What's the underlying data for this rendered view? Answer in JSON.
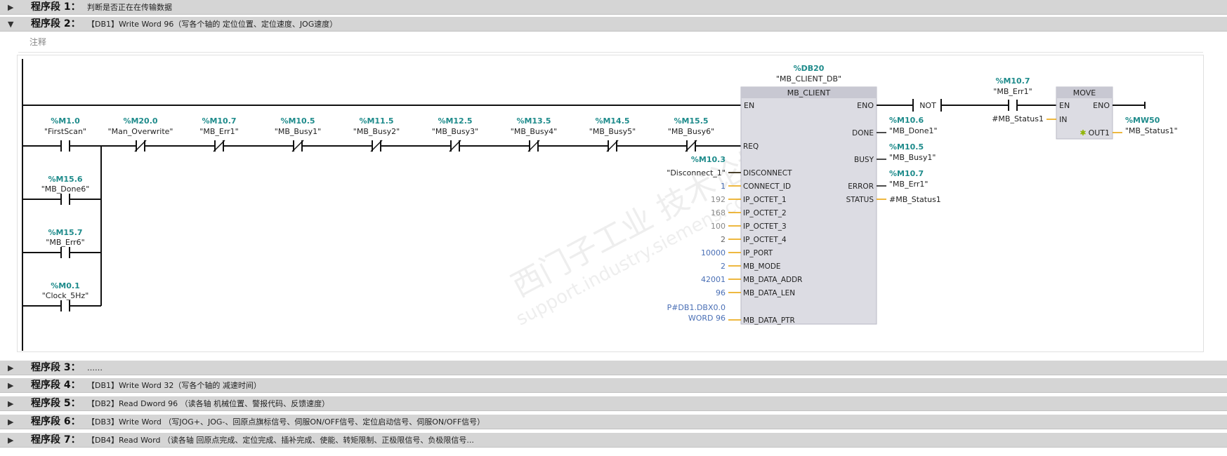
{
  "segments": [
    {
      "title": "程序段 1：",
      "desc": "判断是否正在在传输数据",
      "expanded": false
    },
    {
      "title": "程序段 2：",
      "desc": "【DB1】Write Word 96（写各个轴的 定位位置、定位速度、JOG速度）",
      "expanded": true
    },
    {
      "title": "程序段 3：",
      "desc": "……",
      "expanded": false
    },
    {
      "title": "程序段 4：",
      "desc": "【DB1】Write Word 32（写各个轴的 减速时间）",
      "expanded": false
    },
    {
      "title": "程序段 5：",
      "desc": "【DB2】Read Dword 96 （读各轴 机械位置、警报代码、反馈速度）",
      "expanded": false
    },
    {
      "title": "程序段 6：",
      "desc": "【DB3】Write Word （写JOG+、JOG-、回原点旗标信号、伺服ON/OFF信号、定位启动信号、伺服ON/OFF信号）",
      "expanded": false
    },
    {
      "title": "程序段 7：",
      "desc": "【DB4】Read Word （读各轴 回原点完成、定位完成、插补完成、使能、转矩限制、正极限信号、负极限信号...",
      "expanded": false
    }
  ],
  "comment_placeholder": "注释",
  "contacts": [
    {
      "addr": "%M1.0",
      "name": "\"FirstScan\"",
      "type": "NO"
    },
    {
      "addr": "%M20.0",
      "name": "\"Man_Overwrite\"",
      "type": "NC"
    },
    {
      "addr": "%M10.7",
      "name": "\"MB_Err1\"",
      "type": "NC"
    },
    {
      "addr": "%M10.5",
      "name": "\"MB_Busy1\"",
      "type": "NC"
    },
    {
      "addr": "%M11.5",
      "name": "\"MB_Busy2\"",
      "type": "NC"
    },
    {
      "addr": "%M12.5",
      "name": "\"MB_Busy3\"",
      "type": "NC"
    },
    {
      "addr": "%M13.5",
      "name": "\"MB_Busy4\"",
      "type": "NC"
    },
    {
      "addr": "%M14.5",
      "name": "\"MB_Busy5\"",
      "type": "NC"
    },
    {
      "addr": "%M15.5",
      "name": "\"MB_Busy6\"",
      "type": "NC"
    }
  ],
  "parallel_contacts": [
    {
      "addr": "%M15.6",
      "name": "\"MB_Done6\""
    },
    {
      "addr": "%M15.7",
      "name": "\"MB_Err6\""
    },
    {
      "addr": "%M0.1",
      "name": "\"Clock_5Hz\""
    }
  ],
  "mb_client": {
    "db_addr": "%DB20",
    "db_name": "\"MB_CLIENT_DB\"",
    "title": "MB_CLIENT",
    "en": "EN",
    "eno": "ENO",
    "inputs": [
      {
        "pin": "REQ",
        "value": ""
      },
      {
        "pin": "DISCONNECT",
        "addr": "%M10.3",
        "value": "\"Disconnect_1\""
      },
      {
        "pin": "CONNECT_ID",
        "value": "1"
      },
      {
        "pin": "IP_OCTET_1",
        "value": "192"
      },
      {
        "pin": "IP_OCTET_2",
        "value": "168"
      },
      {
        "pin": "IP_OCTET_3",
        "value": "100"
      },
      {
        "pin": "IP_OCTET_4",
        "value": "2"
      },
      {
        "pin": "IP_PORT",
        "value": "10000"
      },
      {
        "pin": "MB_MODE",
        "value": "2"
      },
      {
        "pin": "MB_DATA_ADDR",
        "value": "42001"
      },
      {
        "pin": "MB_DATA_LEN",
        "value": "96"
      },
      {
        "pin": "MB_DATA_PTR",
        "value": "P#DB1.DBX0.0",
        "value2": "WORD 96"
      }
    ],
    "outputs": [
      {
        "pin": "DONE",
        "addr": "%M10.6",
        "value": "\"MB_Done1\""
      },
      {
        "pin": "BUSY",
        "addr": "%M10.5",
        "value": "\"MB_Busy1\""
      },
      {
        "pin": "ERROR",
        "addr": "%M10.7",
        "value": "\"MB_Err1\""
      },
      {
        "pin": "STATUS",
        "addr": "",
        "value": "#MB_Status1"
      }
    ]
  },
  "not_label": "NOT",
  "err_contact": {
    "addr": "%M10.7",
    "name": "\"MB_Err1\""
  },
  "move": {
    "title": "MOVE",
    "en": "EN",
    "eno": "ENO",
    "in_pin": "IN",
    "in_value": "#MB_Status1",
    "out_pin": "OUT1",
    "out_addr": "%MW50",
    "out_value": "\"MB_Status1\""
  },
  "watermark": {
    "line1": "西门子工业 技术论坛",
    "line2": "support.industry.siemens.com"
  },
  "colors": {
    "addr": "#1e8b8b",
    "box": "#dcdce3",
    "box_header": "#c8c8d2",
    "orange": "#e8a000",
    "const": "#4a6fb5"
  }
}
